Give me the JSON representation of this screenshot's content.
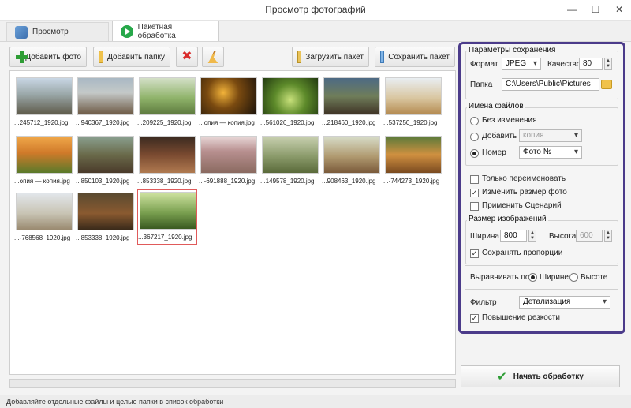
{
  "window": {
    "title": "Просмотр фотографий"
  },
  "tabs": [
    {
      "label": "Просмотр"
    },
    {
      "label": "Пакетная обработка"
    }
  ],
  "toolbar": {
    "add_photo": "Добавить фото",
    "add_folder": "Добавить папку",
    "load_batch": "Загрузить пакет",
    "save_batch": "Сохранить пакет"
  },
  "files": [
    "...245712_1920.jpg",
    "...940367_1920.jpg",
    "...209225_1920.jpg",
    "...опия — копия.jpg",
    "...561026_1920.jpg",
    "...218460_1920.jpg",
    "...537250_1920.jpg",
    "...опия — копия.jpg",
    "...850103_1920.jpg",
    "...853338_1920.jpg",
    "...-691888_1920.jpg",
    "...149578_1920.jpg",
    "...908463_1920.jpg",
    "...-744273_1920.jpg",
    "...-768568_1920.jpg",
    "...853338_1920.jpg",
    "...367217_1920.jpg"
  ],
  "settings": {
    "save_params_title": "Параметры сохранения",
    "format_label": "Формат",
    "format_value": "JPEG",
    "quality_label": "Качество",
    "quality_value": "80",
    "folder_label": "Папка",
    "folder_value": "C:\\Users\\Public\\Pictures",
    "filenames_title": "Имена файлов",
    "opt_no_change": "Без изменения",
    "opt_add": "Добавить",
    "opt_add_value": "копия",
    "opt_number": "Номер",
    "opt_number_value": "Фото №",
    "chk_rename_only": "Только переименовать",
    "chk_resize": "Изменить размер фото",
    "chk_scenario": "Применить Сценарий",
    "size_title": "Размер изображений",
    "width_label": "Ширина",
    "width_value": "800",
    "height_label": "Высота",
    "height_value": "600",
    "chk_keep_ratio": "Сохранять пропорции",
    "align_label": "Выравнивать по:",
    "align_width": "Ширине",
    "align_height": "Высоте",
    "filter_label": "Фильтр",
    "filter_value": "Детализация",
    "chk_sharpen": "Повышение резкости"
  },
  "start_button": "Начать обработку",
  "status": "Добавляйте отдельные файлы и целые папки в список обработки"
}
